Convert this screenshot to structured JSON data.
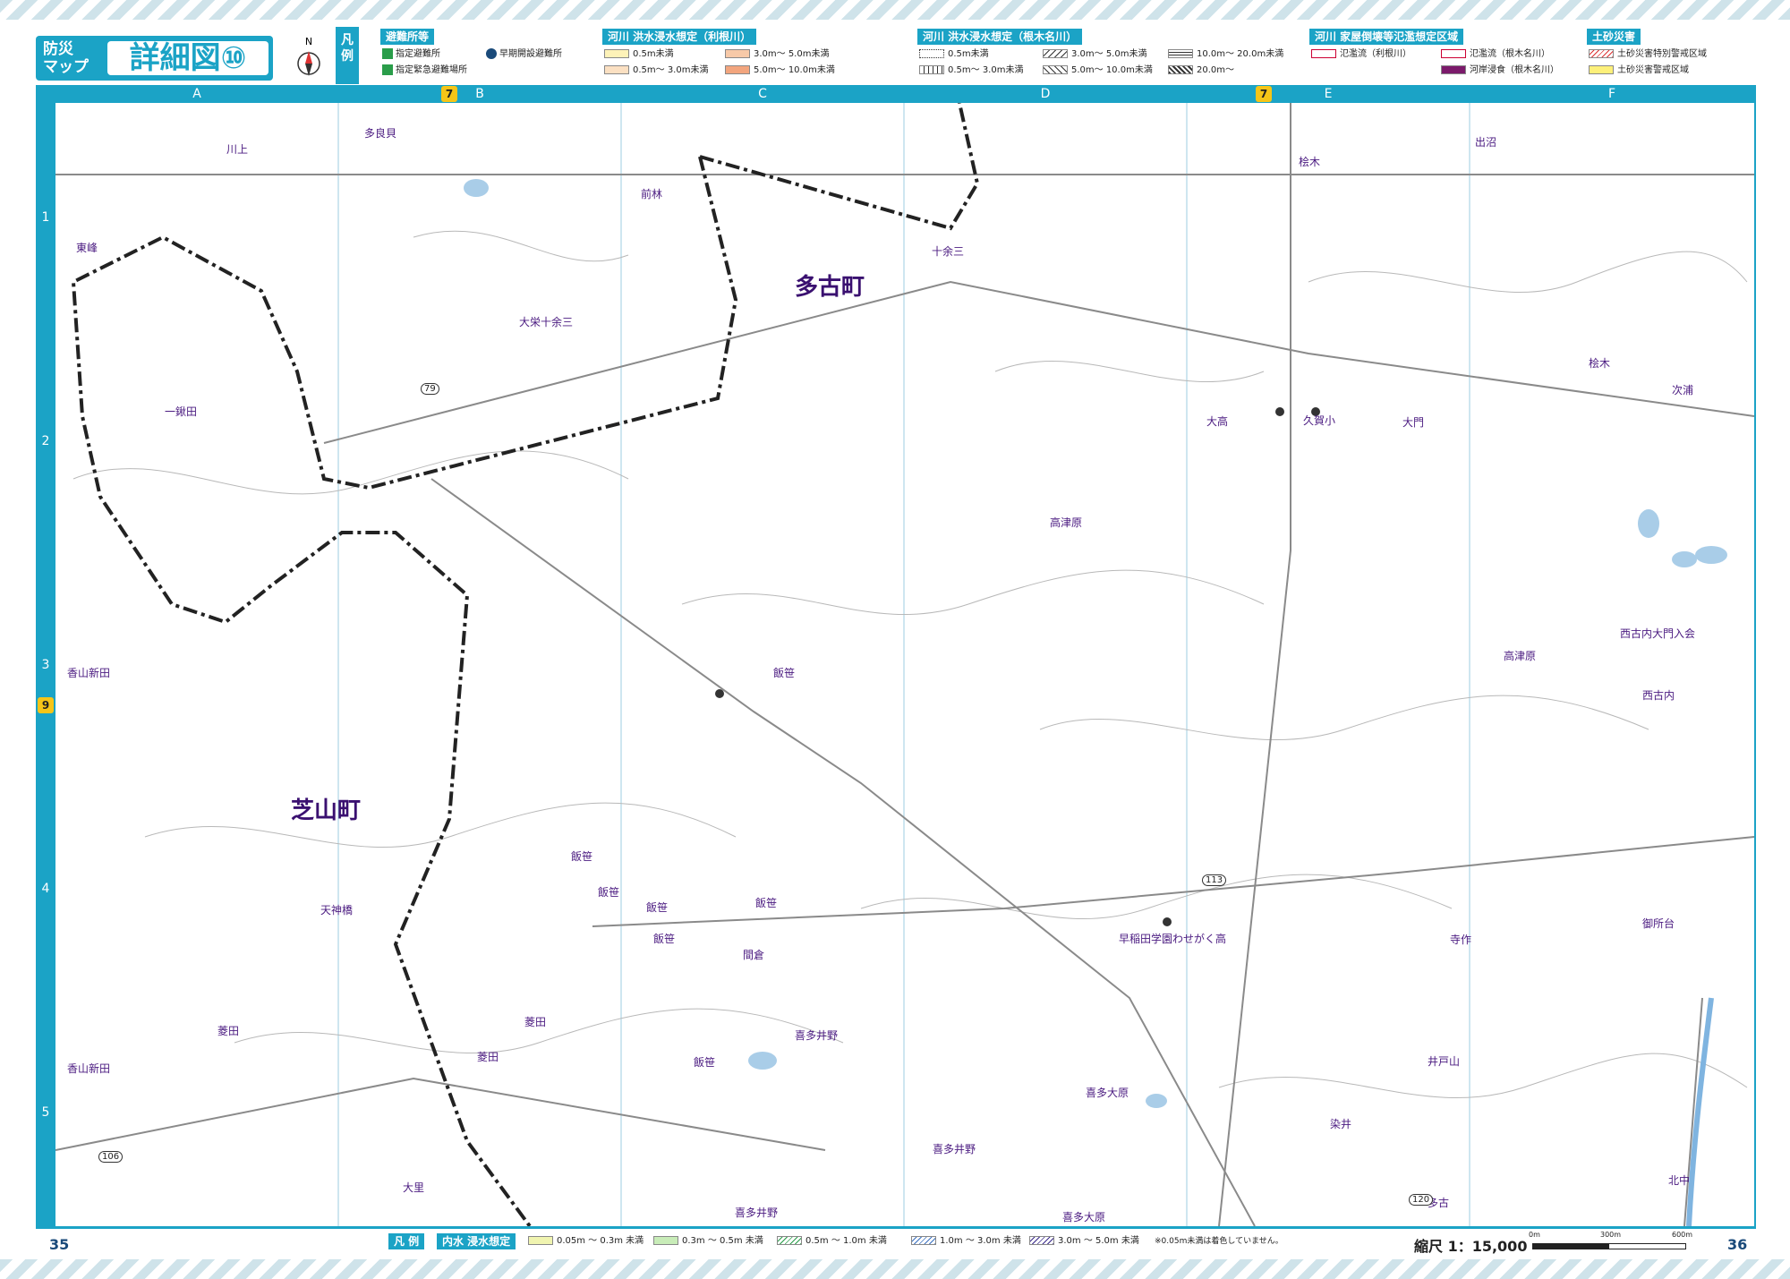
{
  "header": {
    "title_small": "防災\nマップ",
    "title_main": "詳細図⑩",
    "compass_letter": "N",
    "legend_tag": "凡\n例"
  },
  "legend": {
    "shelters": {
      "heading": "避難所等",
      "items": [
        "指定避難所",
        "指定緊急避難場所",
        "早期開設避難所"
      ]
    },
    "tone_flood": {
      "heading": "河川 洪水浸水想定（利根川）",
      "items": [
        {
          "label": "0.5m未満",
          "color": "#fdf2b8"
        },
        {
          "label": "3.0m～ 5.0m未満",
          "color": "#f7c9a8"
        },
        {
          "label": "0.5m～ 3.0m未満",
          "color": "#fbe0c2"
        },
        {
          "label": "5.0m～ 10.0m未満",
          "color": "#f2a57e"
        }
      ]
    },
    "nemuna_flood": {
      "heading": "河川 洪水浸水想定（根木名川）",
      "items": [
        {
          "label": "0.5m未満"
        },
        {
          "label": "3.0m～ 5.0m未満"
        },
        {
          "label": "10.0m～ 20.0m未満"
        },
        {
          "label": "0.5m～ 3.0m未満"
        },
        {
          "label": "5.0m～ 10.0m未満"
        },
        {
          "label": "20.0m～"
        }
      ]
    },
    "house_collapse": {
      "heading": "河川 家屋倒壊等氾濫想定区域",
      "items": [
        "氾濫流（利根川）",
        "氾濫流（根木名川）",
        "河岸浸食（根木名川）"
      ]
    },
    "landslide": {
      "heading": "土砂災害",
      "items": [
        "土砂災害特別警戒区域",
        "土砂災害警戒区域"
      ]
    }
  },
  "grid": {
    "columns": [
      "A",
      "B",
      "C",
      "D",
      "E",
      "F"
    ],
    "rows": [
      "1",
      "2",
      "3",
      "4",
      "5"
    ],
    "adjacent_tags": [
      "7",
      "7",
      "9"
    ]
  },
  "towns": [
    "多古町",
    "芝山町"
  ],
  "places": [
    "多良貝",
    "川上",
    "前林",
    "出沼",
    "桧木",
    "東峰",
    "十余三",
    "大栄十余三",
    "一鍬田",
    "大高",
    "久賀小",
    "大門",
    "桧木",
    "次浦",
    "高津原",
    "香山新田",
    "飯笹",
    "高津原",
    "西古内大門入会",
    "西古内",
    "飯笹",
    "飯笹",
    "飯笹",
    "飯笹",
    "飯笹",
    "間倉",
    "天神橋",
    "早稲田学園わせがく高",
    "寺作",
    "御所台",
    "菱田",
    "菱田",
    "菱田",
    "喜多井野",
    "飯笹",
    "香山新田",
    "喜多大原",
    "井戸山",
    "染井",
    "喜多井野",
    "大里",
    "喜多井野",
    "喜多大原",
    "多古",
    "北中"
  ],
  "road_numbers": [
    "79",
    "113",
    "106",
    "120"
  ],
  "footer": {
    "page_left": "35",
    "page_right": "36",
    "inland_label": "凡 例",
    "inland_heading": "内水 浸水想定",
    "inland_items": [
      "0.05m ～ 0.3m 未満",
      "0.3m ～ 0.5m 未満",
      "0.5m ～ 1.0m 未満",
      "1.0m ～ 3.0m 未満",
      "3.0m ～ 5.0m 未満"
    ],
    "inland_note": "※0.05m未満は着色していません。",
    "scale": "縮尺 1：15,000",
    "scale_ticks": [
      "0m",
      "300m",
      "600m"
    ]
  }
}
